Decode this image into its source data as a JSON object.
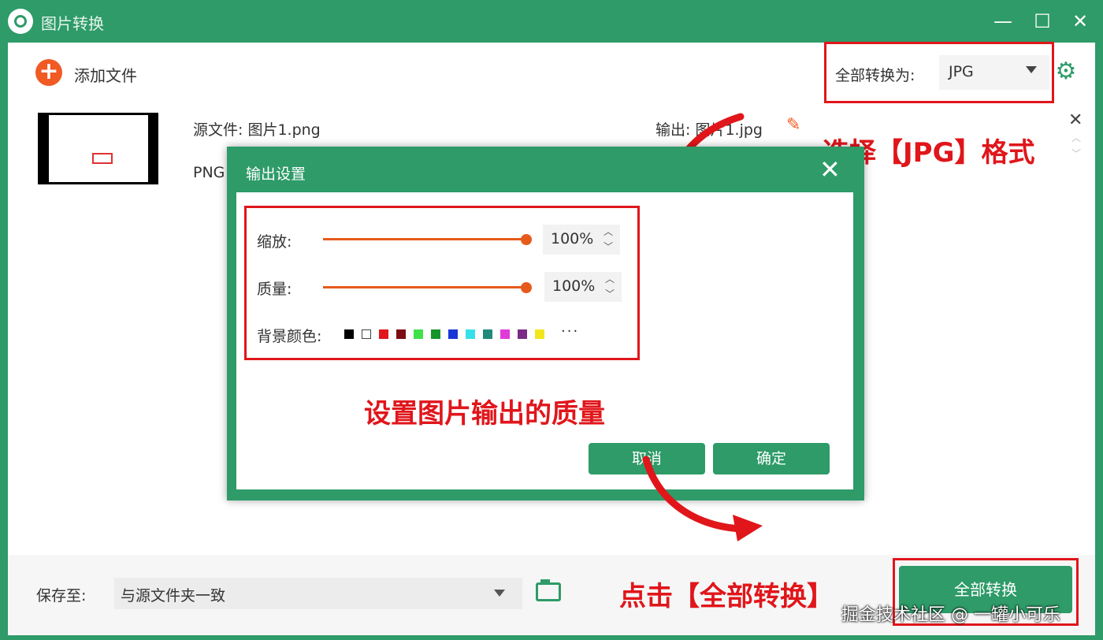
{
  "window": {
    "title": "图片转换",
    "minimize_glyph": "—",
    "maximize_glyph": "☐",
    "close_glyph": "✕"
  },
  "toolbar": {
    "add_label": "添加文件",
    "add_icon": "plus-circle-icon",
    "convert_all_to_label": "全部转换为:",
    "format_value": "JPG",
    "settings_icon": "gear-icon",
    "settings_glyph": "⚙"
  },
  "file_row": {
    "source_label": "源文件: 图片1.png",
    "source_format": "PNG",
    "output_label": "输出: 图片1.jpg",
    "edit_glyph": "✎",
    "remove_glyph": "✕",
    "up_glyph": "︿",
    "down_glyph": "﹀"
  },
  "annotations": {
    "select_format": "选择【JPG】格式",
    "set_quality": "设置图片输出的质量",
    "click_convert": "点击【全部转换】"
  },
  "dialog": {
    "title": "输出设置",
    "close_glyph": "✕",
    "scale_label": "缩放:",
    "scale_value": "100%",
    "scale_level_percent": 100,
    "quality_label": "质量:",
    "quality_value": "100%",
    "quality_level_percent": 100,
    "bg_color_label": "背景颜色:",
    "bg_colors": [
      "#000000",
      "#ffffff",
      "#e0161b",
      "#7a0d16",
      "#3fe04a",
      "#15942a",
      "#1836d6",
      "#36e0e8",
      "#1f8a7a",
      "#e03ad8",
      "#7a2a86",
      "#f2e61d"
    ],
    "more_colors": "···",
    "spin_up": "︿",
    "spin_down": "﹀",
    "cancel_label": "取消",
    "confirm_label": "确定"
  },
  "footer": {
    "save_to_label": "保存至:",
    "save_to_value": "与源文件夹一致",
    "convert_all_label": "全部转换"
  },
  "watermark": "掘金技术社区 @ 一罐小可乐",
  "colors": {
    "brand": "#2e9b68",
    "accent": "#f15a22",
    "annotation": "#e0161b"
  }
}
